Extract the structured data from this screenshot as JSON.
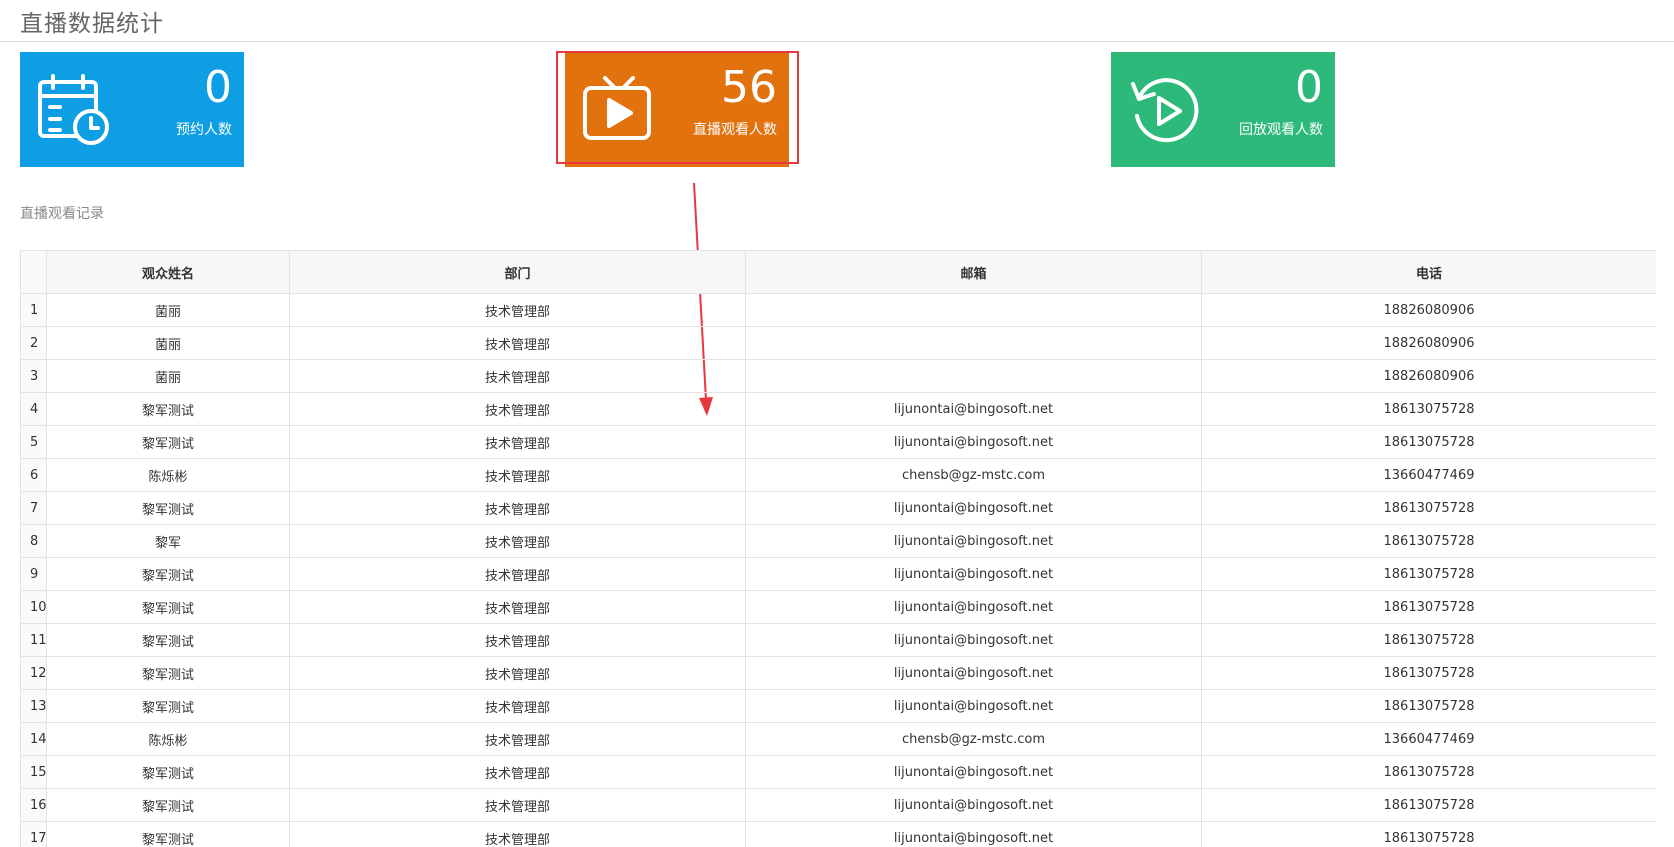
{
  "page": {
    "title": "直播数据统计"
  },
  "stats": [
    {
      "value": "0",
      "label": "预约人数",
      "icon": "calendar-clock-icon",
      "color": "#0d9ee3"
    },
    {
      "value": "56",
      "label": "直播观看人数",
      "icon": "tv-play-icon",
      "color": "#e2720e"
    },
    {
      "value": "0",
      "label": "回放观看人数",
      "icon": "replay-icon",
      "color": "#2db97a"
    }
  ],
  "section": {
    "label": "直播观看记录"
  },
  "table": {
    "columns": [
      "",
      "观众姓名",
      "部门",
      "邮箱",
      "电话"
    ],
    "rows": [
      [
        "1",
        "菌丽",
        "技术管理部",
        "",
        "18826080906"
      ],
      [
        "2",
        "菌丽",
        "技术管理部",
        "",
        "18826080906"
      ],
      [
        "3",
        "菌丽",
        "技术管理部",
        "",
        "18826080906"
      ],
      [
        "4",
        "黎军测试",
        "技术管理部",
        "lijunontai@bingosoft.net",
        "18613075728"
      ],
      [
        "5",
        "黎军测试",
        "技术管理部",
        "lijunontai@bingosoft.net",
        "18613075728"
      ],
      [
        "6",
        "陈烁彬",
        "技术管理部",
        "chensb@gz-mstc.com",
        "13660477469"
      ],
      [
        "7",
        "黎军测试",
        "技术管理部",
        "lijunontai@bingosoft.net",
        "18613075728"
      ],
      [
        "8",
        "黎军",
        "技术管理部",
        "lijunontai@bingosoft.net",
        "18613075728"
      ],
      [
        "9",
        "黎军测试",
        "技术管理部",
        "lijunontai@bingosoft.net",
        "18613075728"
      ],
      [
        "10",
        "黎军测试",
        "技术管理部",
        "lijunontai@bingosoft.net",
        "18613075728"
      ],
      [
        "11",
        "黎军测试",
        "技术管理部",
        "lijunontai@bingosoft.net",
        "18613075728"
      ],
      [
        "12",
        "黎军测试",
        "技术管理部",
        "lijunontai@bingosoft.net",
        "18613075728"
      ],
      [
        "13",
        "黎军测试",
        "技术管理部",
        "lijunontai@bingosoft.net",
        "18613075728"
      ],
      [
        "14",
        "陈烁彬",
        "技术管理部",
        "chensb@gz-mstc.com",
        "13660477469"
      ],
      [
        "15",
        "黎军测试",
        "技术管理部",
        "lijunontai@bingosoft.net",
        "18613075728"
      ],
      [
        "16",
        "黎军测试",
        "技术管理部",
        "lijunontai@bingosoft.net",
        "18613075728"
      ],
      [
        "17",
        "黎军测试",
        "技术管理部",
        "lijunontai@bingosoft.net",
        "18613075728"
      ]
    ]
  },
  "annotation": {
    "highlight_color": "#e8383d"
  }
}
